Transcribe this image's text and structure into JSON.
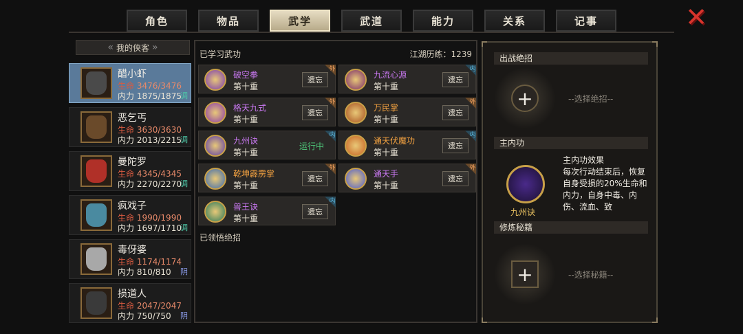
{
  "tabs": [
    "角色",
    "物品",
    "武学",
    "武道",
    "能力",
    "关系",
    "记事"
  ],
  "active_tab": 2,
  "close_icon": "close-x-icon",
  "sidebar": {
    "header": "我的侠客",
    "heroes": [
      {
        "name": "醋小虾",
        "hp_label": "生命",
        "hp": "3476/3476",
        "mp_label": "内力",
        "mp": "1875/1875",
        "tag": "调",
        "tag_color": "#4ec8a8",
        "face": "#4a4a4a",
        "selected": true
      },
      {
        "name": "恶乞丐",
        "hp_label": "生命",
        "hp": "3630/3630",
        "mp_label": "内力",
        "mp": "2013/2215",
        "tag": "调",
        "tag_color": "#4ec8a8",
        "face": "#6a4a2a",
        "selected": false
      },
      {
        "name": "曼陀罗",
        "hp_label": "生命",
        "hp": "4345/4345",
        "mp_label": "内力",
        "mp": "2270/2270",
        "tag": "调",
        "tag_color": "#4ec8a8",
        "face": "#b03028",
        "selected": false
      },
      {
        "name": "疯戏子",
        "hp_label": "生命",
        "hp": "1990/1990",
        "mp_label": "内力",
        "mp": "1697/1710",
        "tag": "调",
        "tag_color": "#4ec8a8",
        "face": "#4a8aa0",
        "selected": false
      },
      {
        "name": "毒伢婆",
        "hp_label": "生命",
        "hp": "1174/1174",
        "mp_label": "内力",
        "mp": "810/810",
        "tag": "阴",
        "tag_color": "#8a9ae8",
        "face": "#a8a8a8",
        "selected": false
      },
      {
        "name": "损道人",
        "hp_label": "生命",
        "hp": "2047/2047",
        "mp_label": "内力",
        "mp": "750/750",
        "tag": "阴",
        "tag_color": "#8a9ae8",
        "face": "#3a3a3a",
        "selected": false
      }
    ]
  },
  "middle": {
    "learned_title": "已学习武功",
    "exp_label": "江湖历练：1239",
    "mastered_title": "已领悟绝招",
    "forget_label": "遗忘",
    "running_label": "运行中",
    "skills": [
      {
        "name": "破空拳",
        "level": "第十重",
        "name_color": "#c878f0",
        "badge": "外",
        "badge_type": "out",
        "icon_color": "#7a3ab0",
        "running": false
      },
      {
        "name": "九流心源",
        "level": "第十重",
        "name_color": "#c878f0",
        "badge": "内",
        "badge_type": "in",
        "icon_color": "#7a2a6a",
        "running": false
      },
      {
        "name": "格天九式",
        "level": "第十重",
        "name_color": "#c878f0",
        "badge": "外",
        "badge_type": "out",
        "icon_color": "#8a3aa8",
        "running": false
      },
      {
        "name": "万民掌",
        "level": "第十重",
        "name_color": "#f0a040",
        "badge": "外",
        "badge_type": "out",
        "icon_color": "#a85020",
        "running": false
      },
      {
        "name": "九州诀",
        "level": "第十重",
        "name_color": "#c878f0",
        "badge": "内",
        "badge_type": "in",
        "icon_color": "#5a3aa8",
        "running": true
      },
      {
        "name": "通天伏魔功",
        "level": "第十重",
        "name_color": "#f0a040",
        "badge": "内",
        "badge_type": "in",
        "icon_color": "#c86020",
        "running": false
      },
      {
        "name": "乾坤霹雳掌",
        "level": "第十重",
        "name_color": "#f0a040",
        "badge": "外",
        "badge_type": "out",
        "icon_color": "#3a6ab0",
        "running": false
      },
      {
        "name": "通天手",
        "level": "第十重",
        "name_color": "#c878f0",
        "badge": "外",
        "badge_type": "out",
        "icon_color": "#4a5ad0",
        "running": false
      },
      {
        "name": "兽王诀",
        "level": "第十重",
        "name_color": "#c878f0",
        "badge": "内",
        "badge_type": "in",
        "icon_color": "#2a7a5a",
        "running": false
      }
    ]
  },
  "right": {
    "ultimate_title": "出战绝招",
    "ultimate_hint": "--选择绝招--",
    "neigong_title": "主内功",
    "neigong_name": "九州诀",
    "effect_title": "主内功效果",
    "effect_text": "每次行动结束后，恢复自身受损的20%生命和内力，自身中毒、内伤、流血、致",
    "manual_title": "修炼秘籍",
    "manual_hint": "--选择秘籍--",
    "plus_symbol": "+"
  }
}
